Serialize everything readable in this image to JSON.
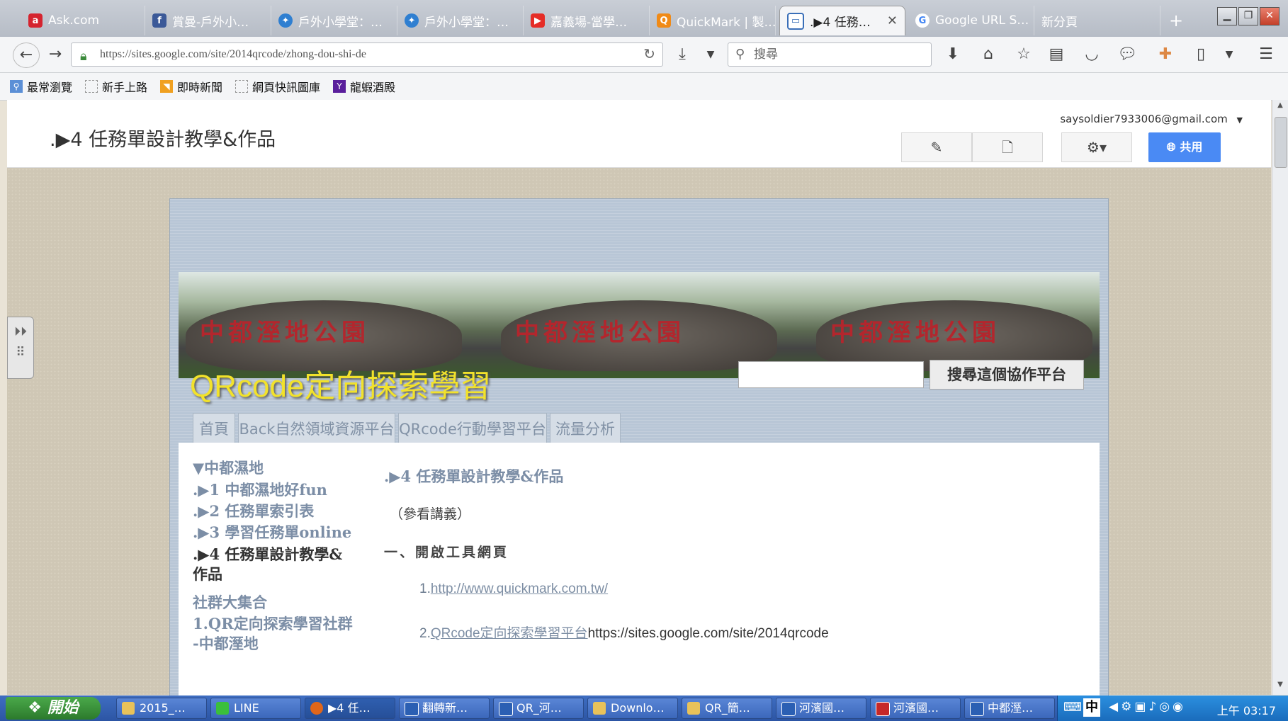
{
  "browser": {
    "tabs": [
      {
        "label": "Ask.com",
        "icon": "ask-icon",
        "color": "#d5242f"
      },
      {
        "label": "賞曼-戶外小…",
        "icon": "facebook-icon",
        "color": "#3b5998"
      },
      {
        "label": "戶外小學堂：…",
        "icon": "sites-icon",
        "color": "#2f7fd1"
      },
      {
        "label": "戶外小學堂：…",
        "icon": "sites-icon",
        "color": "#2f7fd1"
      },
      {
        "label": "嘉義場-當學…",
        "icon": "youtube-icon",
        "color": "#e52d27"
      },
      {
        "label": "QuickMark | 製…",
        "icon": "quickmark-icon",
        "color": "#f08a16"
      },
      {
        "label": ".▶4 任務…",
        "icon": "page-icon",
        "color": "#3a6fb8",
        "active": true
      },
      {
        "label": "Google URL S…",
        "icon": "google-icon",
        "color": "#4285f4"
      },
      {
        "label": "新分頁",
        "icon": "",
        "color": ""
      }
    ],
    "new_tab": "+",
    "url": "https://sites.google.com/site/2014qrcode/zhong-dou-shi-de",
    "search_placeholder": "搜尋",
    "bookmarks": [
      "最常瀏覽",
      "新手上路",
      "即時新聞",
      "網頁快訊圖庫",
      "龍蝦酒殿"
    ]
  },
  "sites_header": {
    "page_title": ".▶4 任務單設計教學&作品",
    "account": "saysoldier7933006@gmail.com",
    "share_label": "共用"
  },
  "site": {
    "title": "QRcode定向探索學習",
    "banner_text": "中都溼地公園",
    "search_button": "搜尋這個協作平台",
    "tabs": [
      "首頁",
      "Back自然領域資源平台",
      "QRcode行動學習平台",
      "流量分析"
    ],
    "sidebar": [
      "▼中都濕地",
      ".▶1 中都濕地好fun",
      ".▶2 任務單索引表",
      ".▶3 學習任務單online",
      ".▶4 任務單設計教學&",
      "作品",
      "社群大集合",
      "1.QR定向探索學習社群",
      "-中都溼地"
    ],
    "main": {
      "heading": ".▶4 任務單設計教學&作品",
      "note": "（參看講義）",
      "section": "一、開啟工具網頁",
      "item1_num": "1.",
      "item1_link": "http://www.quickmark.com.tw/",
      "item2_num": "2.",
      "item2_link": "QRcode定向探索學習平台",
      "item2_url": "https://sites.google.com/site/2014qrcode"
    }
  },
  "taskbar": {
    "start": "開始",
    "items": [
      {
        "label": "2015_…",
        "color": "#e8c25a"
      },
      {
        "label": "LINE",
        "color": "#3bbf3b"
      },
      {
        "label": "▶4 任…",
        "color": "#e0661a"
      },
      {
        "label": "翻轉新…",
        "color": "#2b5fb3"
      },
      {
        "label": "QR_河…",
        "color": "#2b5fb3"
      },
      {
        "label": "Downlo…",
        "color": "#e8c25a"
      },
      {
        "label": "QR_簡…",
        "color": "#e8c25a"
      },
      {
        "label": "河濱國…",
        "color": "#2b5fb3"
      },
      {
        "label": "河濱國…",
        "color": "#c62828"
      },
      {
        "label": "中都溼…",
        "color": "#2b5fb3"
      }
    ],
    "ime": "中",
    "clock": "上午 03:17"
  }
}
